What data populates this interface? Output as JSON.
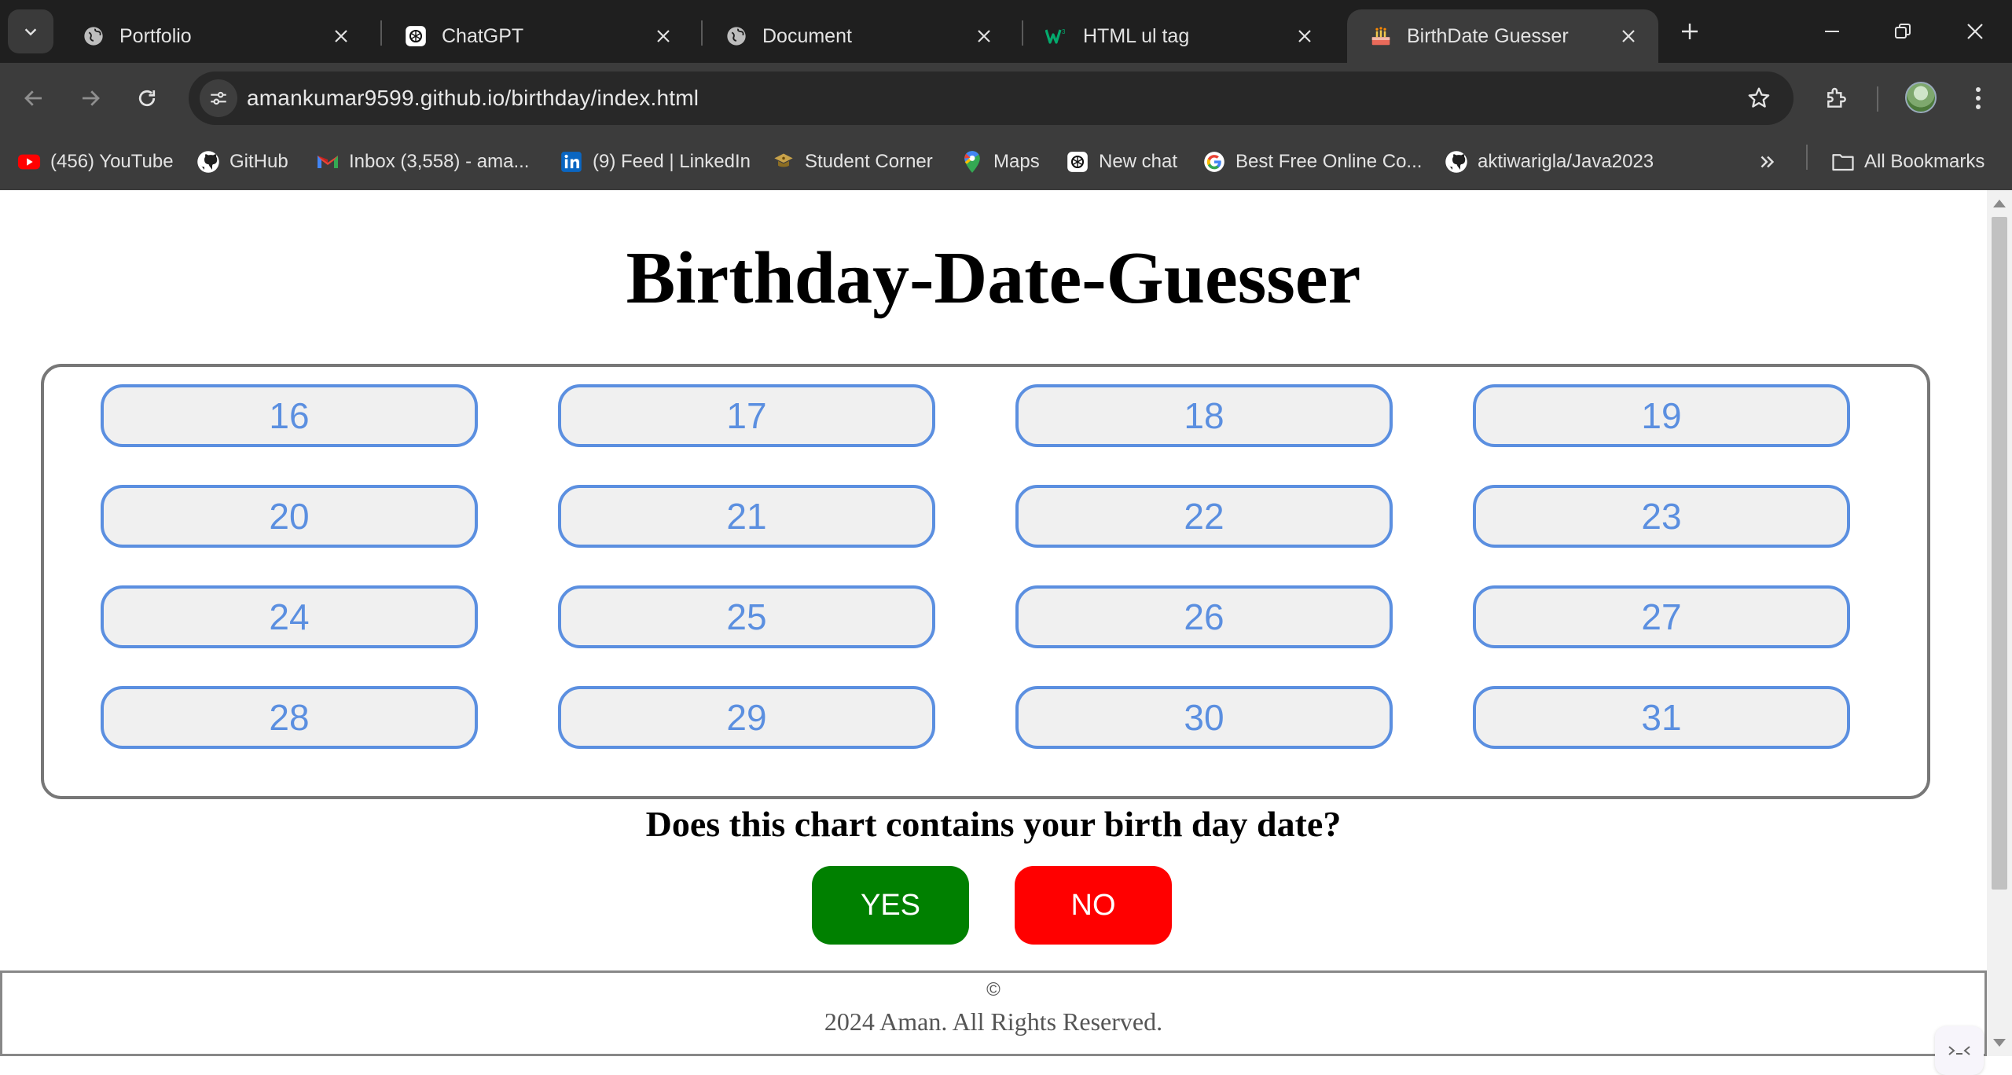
{
  "tabs": [
    {
      "title": "Portfolio",
      "icon": "globe-icon"
    },
    {
      "title": "ChatGPT",
      "icon": "chatgpt-icon"
    },
    {
      "title": "Document",
      "icon": "globe-icon"
    },
    {
      "title": "HTML ul tag",
      "icon": "w3schools-icon"
    },
    {
      "title": "BirthDate Guesser",
      "icon": "cake-icon",
      "active": true
    }
  ],
  "address_bar": {
    "url": "amankumar9599.github.io/birthday/index.html"
  },
  "bookmarks": [
    {
      "label": "(456) YouTube",
      "icon": "youtube-icon"
    },
    {
      "label": "GitHub",
      "icon": "github-icon"
    },
    {
      "label": "Inbox (3,558) - ama...",
      "icon": "gmail-icon"
    },
    {
      "label": "(9) Feed | LinkedIn",
      "icon": "linkedin-icon"
    },
    {
      "label": "Student Corner",
      "icon": "student-corner-icon"
    },
    {
      "label": "Maps",
      "icon": "maps-icon"
    },
    {
      "label": "New chat",
      "icon": "chatgpt-icon"
    },
    {
      "label": "Best Free Online Co...",
      "icon": "google-icon"
    },
    {
      "label": "aktiwarigla/Java2023",
      "icon": "github-icon"
    },
    {
      "label": "All Bookmarks",
      "icon": "folder-icon"
    }
  ],
  "page": {
    "title": "Birthday-Date-Guesser",
    "numbers": [
      "16",
      "17",
      "18",
      "19",
      "20",
      "21",
      "22",
      "23",
      "24",
      "25",
      "26",
      "27",
      "28",
      "29",
      "30",
      "31"
    ],
    "question": "Does this chart contains your birth day date?",
    "yes_label": "YES",
    "no_label": "NO"
  },
  "footer": {
    "copyright_symbol": "©",
    "text": "2024 Aman. All Rights Reserved."
  },
  "colors": {
    "number_border": "#5b8fe0",
    "yes": "#008000",
    "no": "#ff0000"
  }
}
